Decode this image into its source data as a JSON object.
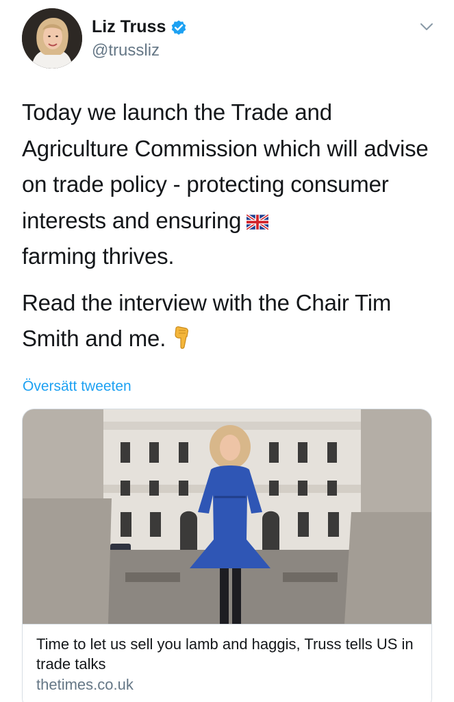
{
  "author": {
    "display_name": "Liz Truss",
    "handle": "@trussliz",
    "verified": true,
    "avatar_icon": "profile-photo"
  },
  "menu": {
    "icon": "chevron-down-icon"
  },
  "tweet": {
    "paragraphs": [
      "Today we launch the Trade and Agriculture Commission which will advise on trade policy - protecting consumer interests and ensuring",
      "farming thrives.",
      "Read the interview with the Chair Tim Smith and me."
    ],
    "emoji": [
      "uk-flag-icon",
      "pointing-down-icon"
    ]
  },
  "translate_label": "Översätt tweeten",
  "link_card": {
    "title": "Time to let us sell you lamb and haggis, Truss tells US in trade talks",
    "domain": "thetimes.co.uk"
  },
  "colors": {
    "accent": "#1da1f2",
    "text": "#14171a",
    "secondary": "#657786",
    "border": "#d6dde3"
  }
}
